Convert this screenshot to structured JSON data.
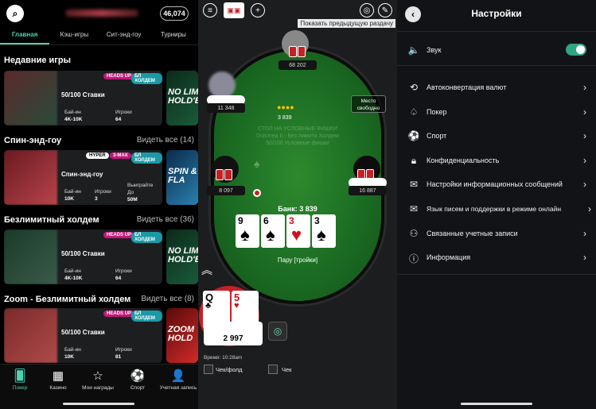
{
  "lobby": {
    "balance": "46,074",
    "tabs": [
      "Главная",
      "Кэш-игры",
      "Сит-энд-гоу",
      "Турниры"
    ],
    "sections": [
      {
        "title": "Недавние игры",
        "see_all": ""
      },
      {
        "title": "Спин-энд-гоу",
        "see_all": "Видеть все (14)"
      },
      {
        "title": "Безлимитный холдем",
        "see_all": "Видеть все (36)"
      },
      {
        "title": "Zoom - Безлимитный холдем",
        "see_all": "Видеть все (8)"
      }
    ],
    "cards": [
      {
        "badges": [
          "HEADS UP",
          "БЛ ХОЛДЕМ"
        ],
        "title": "50/100 Ставки",
        "k1": "Бай-ин",
        "v1": "4K-10K",
        "k2": "Игроки",
        "v2": "64"
      },
      {
        "badges": [
          "HYPER",
          "3-MAX",
          "БЛ ХОЛДЕМ"
        ],
        "title": "Спин-энд-гоу",
        "k1": "Бай-ин",
        "v1": "10K",
        "k2": "Игроки",
        "v2": "3",
        "k3": "Выиграйте До",
        "v3": "50M"
      },
      {
        "badges": [
          "HEADS UP",
          "БЛ ХОЛДЕМ"
        ],
        "title": "50/100 Ставки",
        "k1": "Бай-ин",
        "v1": "4K-10K",
        "k2": "Игроки",
        "v2": "64"
      },
      {
        "badges": [
          "HEADS UP",
          "БЛ ХОЛДЕМ"
        ],
        "title": "50/100 Ставки",
        "k1": "Бай-ин",
        "v1": "10K",
        "k2": "Игроки",
        "v2": "81"
      }
    ],
    "side_tiles": [
      "NO LIMIT HOLD'EM",
      "SPIN & FLA",
      "NO LIMIT HOLD'EM",
      "ZOOM HOLD"
    ],
    "nav": [
      {
        "label": "Покер",
        "icon": "cards-icon"
      },
      {
        "label": "Казино",
        "icon": "casino-icon"
      },
      {
        "label": "Мои награды",
        "icon": "rewards-icon"
      },
      {
        "label": "Спорт",
        "icon": "ball-icon"
      },
      {
        "label": "Учетная запись",
        "icon": "user-icon"
      }
    ]
  },
  "table": {
    "show_previous": "Показать предыдущую раздачу",
    "free_seat": "Место свободно",
    "watermark": [
      "СТОЛ НА УСЛОВНЫЕ ФИШКИ",
      "Dulcinea II - Без лимита Холдем",
      "50/100 Условные фишки"
    ],
    "pot_chips": "3 839",
    "bank": "Банк: 3 839",
    "combo": "Пару [тройки]",
    "stacks": {
      "top": "68 202",
      "left_top": "11 348",
      "left": "8 097",
      "right": "16 887",
      "hero": "2 997"
    },
    "board": [
      {
        "rank": "9",
        "suit": "♠",
        "red": false
      },
      {
        "rank": "6",
        "suit": "♠",
        "red": false
      },
      {
        "rank": "3",
        "suit": "♥",
        "red": true
      },
      {
        "rank": "3",
        "suit": "♠",
        "red": false
      }
    ],
    "hero_cards": [
      {
        "rank": "Q",
        "suit": "♣",
        "red": false
      },
      {
        "rank": "5",
        "suit": "♥",
        "red": true
      }
    ],
    "time": "Время: 10:28am",
    "check_fold": "Чек/фолд",
    "check": "Чек"
  },
  "settings": {
    "title": "Настройки",
    "sound": "Звук",
    "items": [
      {
        "label": "Автоконвертация валют",
        "icon": "currency-icon"
      },
      {
        "label": "Покер",
        "icon": "spade-icon"
      },
      {
        "label": "Спорт",
        "icon": "ball-icon"
      },
      {
        "label": "Конфиденциальность",
        "icon": "lock-icon"
      },
      {
        "label": "Настройки информационных сообщений",
        "icon": "message-icon"
      },
      {
        "label": "Язык писем и поддержки в режиме онлайн",
        "icon": "mail-icon"
      },
      {
        "label": "Связанные учетные записи",
        "icon": "linked-accounts-icon"
      },
      {
        "label": "Информация",
        "icon": "info-icon"
      }
    ]
  },
  "colors": {
    "accent": "#4fd1b2",
    "felt": "#1a6a22",
    "toggle": "#2fa584",
    "badge_pink": "#c2187a",
    "badge_teal": "#1a9aa6"
  }
}
